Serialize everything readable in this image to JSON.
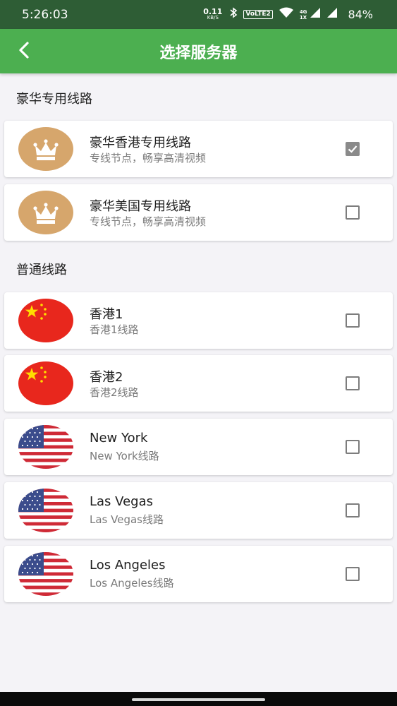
{
  "status_bar": {
    "time": "5:26:03",
    "speed_value": "0.11",
    "speed_unit": "KB/S",
    "volte": "VoLTE2",
    "network_type": "4G",
    "network_sub": "1X",
    "battery": "84%"
  },
  "app_bar": {
    "title": "选择服务器",
    "back_icon": "chevron-left-icon"
  },
  "sections": [
    {
      "title": "豪华专用线路",
      "items": [
        {
          "name": "豪华香港专用线路",
          "subtitle": "专线节点，畅享高清视频",
          "icon": "crown-icon",
          "checked": true
        },
        {
          "name": "豪华美国专用线路",
          "subtitle": "专线节点，畅享高清视频",
          "icon": "crown-icon",
          "checked": false
        }
      ]
    },
    {
      "title": "普通线路",
      "items": [
        {
          "name": "香港1",
          "subtitle": "香港1线路",
          "icon": "china-flag-icon",
          "checked": false
        },
        {
          "name": "香港2",
          "subtitle": "香港2线路",
          "icon": "china-flag-icon",
          "checked": false
        },
        {
          "name": "New York",
          "subtitle": "New York线路",
          "icon": "usa-flag-icon",
          "checked": false
        },
        {
          "name": "Las Vegas",
          "subtitle": "Las Vegas线路",
          "icon": "usa-flag-icon",
          "checked": false
        },
        {
          "name": "Los Angeles",
          "subtitle": "Los Angeles线路",
          "icon": "usa-flag-icon",
          "checked": false
        }
      ]
    }
  ],
  "colors": {
    "app_bar": "#4caf50",
    "status_bar": "#2e5d35",
    "background": "#f4f3f7",
    "crown_circle": "#d6a66c",
    "checkbox_checked": "#8a8a8a"
  }
}
